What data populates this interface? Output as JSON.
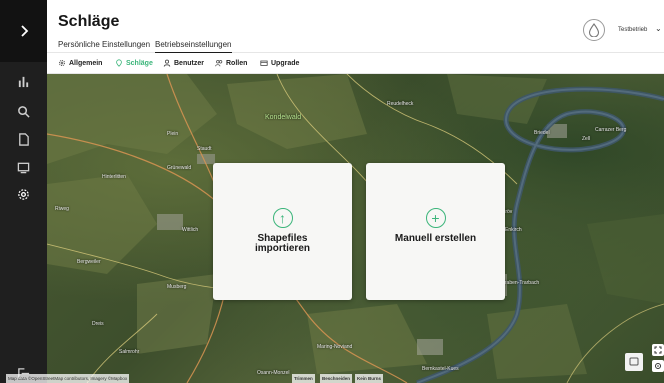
{
  "sidebar": {
    "toggle_icon": "chevron-right-icon",
    "items": [
      {
        "icon": "bar-chart-icon"
      },
      {
        "icon": "search-icon"
      },
      {
        "icon": "document-icon"
      },
      {
        "icon": "monitor-icon"
      },
      {
        "icon": "settings-gear-icon",
        "active": true
      }
    ],
    "bottom_icon": "logout-icon"
  },
  "header": {
    "title": "Schläge",
    "tabs": [
      {
        "label": "Persönliche Einstellungen",
        "active": false
      },
      {
        "label": "Betriebseinstellungen",
        "active": true
      }
    ],
    "user": {
      "name": "Testbetrieb",
      "logo_icon": "drop-logo-icon"
    }
  },
  "subnav": {
    "items": [
      {
        "label": "Allgemein",
        "icon": "gear-icon"
      },
      {
        "label": "Schläge",
        "icon": "location-pin-icon",
        "active": true
      },
      {
        "label": "Benutzer",
        "icon": "user-icon"
      },
      {
        "label": "Rollen",
        "icon": "users-icon"
      },
      {
        "label": "Upgrade",
        "icon": "card-icon"
      }
    ]
  },
  "map": {
    "labels": {
      "kondelwald": "Kondelwald",
      "reudelheck": "Reudelheck",
      "staudt": "Staudt",
      "grunewald": "Grünewald",
      "hinterlitten": "Hinterlitten",
      "wittlich": "Wittlich",
      "bergweiler": "Bergweiler",
      "musberg": "Musberg",
      "dreis": "Dreis",
      "salmrohr": "Salmrohr",
      "maring": "Maring-Noviand",
      "osann": "Osann-Monzel",
      "bernkastel": "Bernkastel-Kues",
      "kroev": "Kröv",
      "zell": "Zell",
      "carrazer": "Carrazer Berg",
      "traben": "Traben-Trarbach",
      "enkirch": "Enkirch",
      "briedel": "Briedel",
      "plein": "Plein",
      "riwg": "Riweg"
    },
    "attribution": "Map data ©OpenStreetMap contributors, Imagery ©Mapbox",
    "buttons": {
      "simplify": "Trimmen",
      "cut": "Beschneiden",
      "none": "Kein Burns"
    }
  },
  "cards": [
    {
      "label_line1": "Shapefiles",
      "label_line2": "importieren",
      "icon": "upload-icon",
      "icon_glyph": "↑"
    },
    {
      "label_line1": "Manuell erstellen",
      "label_line2": "",
      "icon": "plus-circle-icon",
      "icon_glyph": "+"
    }
  ],
  "colors": {
    "accent": "#3bb57a",
    "sidebar": "#1f1f1f"
  }
}
